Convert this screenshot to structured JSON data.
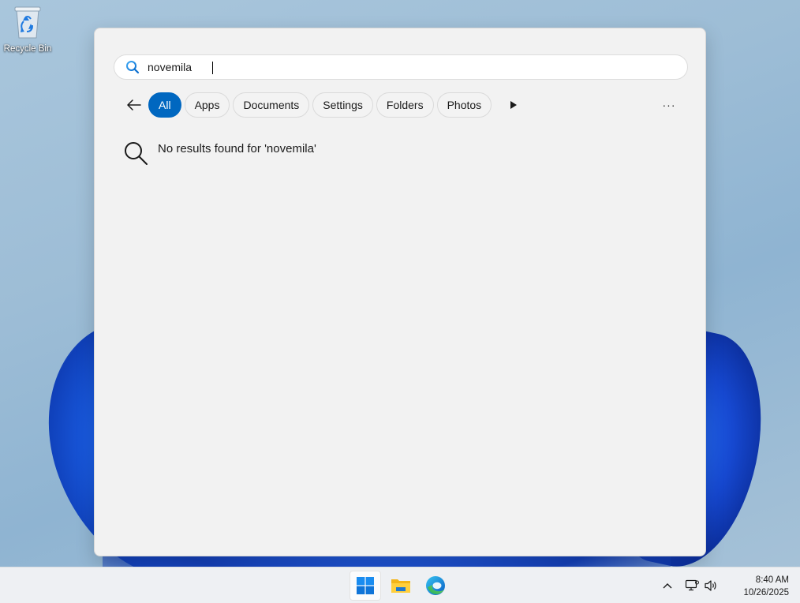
{
  "desktop": {
    "icons": [
      {
        "label": "Recycle Bin",
        "icon": "recycle-bin-icon"
      }
    ]
  },
  "search": {
    "query": "novemila",
    "icon": "search-icon"
  },
  "filters": {
    "back_icon": "back-arrow-icon",
    "chips": [
      {
        "label": "All",
        "active": true
      },
      {
        "label": "Apps",
        "active": false
      },
      {
        "label": "Documents",
        "active": false
      },
      {
        "label": "Settings",
        "active": false
      },
      {
        "label": "Folders",
        "active": false
      },
      {
        "label": "Photos",
        "active": false
      }
    ],
    "more_scopes_icon": "play-right-icon",
    "more_label": "···"
  },
  "results": {
    "message": "No results found for 'novemila'",
    "icon": "search-icon"
  },
  "taskbar": {
    "apps": [
      {
        "name": "Start",
        "icon": "windows-logo-icon"
      },
      {
        "name": "File Explorer",
        "icon": "folder-icon"
      },
      {
        "name": "Microsoft Edge",
        "icon": "edge-icon"
      }
    ],
    "tray": {
      "icons": [
        "chevron-up-icon",
        "network-icon",
        "volume-icon"
      ],
      "time": "8:40 AM",
      "date": "10/26/2025"
    }
  },
  "colors": {
    "accent": "#0067c0",
    "panel_bg": "#f2f2f2",
    "taskbar_bg": "#eef0f3"
  }
}
